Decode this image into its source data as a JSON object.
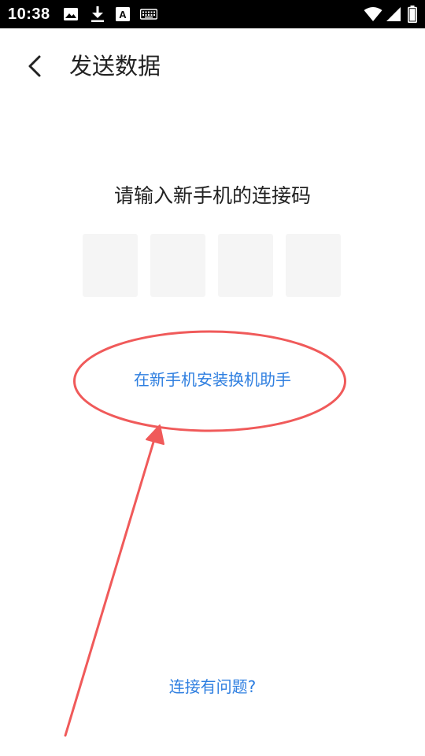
{
  "status_bar": {
    "time": "10:38",
    "left_icons": [
      "image-icon",
      "download-icon",
      "a-letter-icon",
      "keyboard-icon"
    ],
    "a_icon_letter": "A",
    "right_icons": [
      "wifi-icon",
      "signal-icon",
      "battery-icon"
    ]
  },
  "header": {
    "back_icon": "chevron-left-icon",
    "title": "发送数据"
  },
  "main": {
    "prompt": "请输入新手机的连接码",
    "code_boxes": [
      "",
      "",
      "",
      ""
    ],
    "install_link": "在新手机安装换机助手",
    "help_link": "连接有问题?"
  },
  "annotation": {
    "color": "#f05a5a",
    "shapes": [
      "ellipse-highlight",
      "arrow"
    ]
  }
}
